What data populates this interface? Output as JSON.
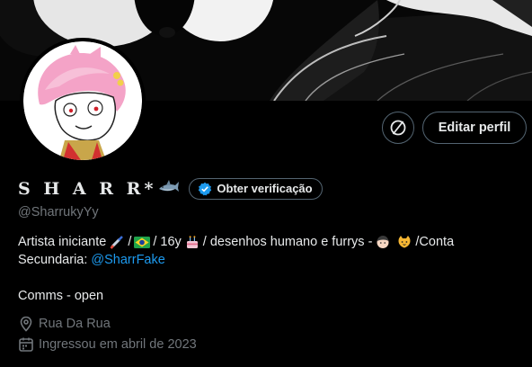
{
  "profile": {
    "display_name": "S H A R R*",
    "handle": "@SharrukyYy",
    "verify_label": "Obter verificação",
    "edit_label": "Editar perfil",
    "bio": {
      "line1_part1": "Artista iniciante",
      "line1_part2": "/",
      "line1_part3": "/ 16y",
      "line1_part4": "/ desenhos humano e furrys -",
      "line1_part5": "/Conta",
      "line2_part1": "Secundaria:",
      "line2_link": "@SharrFake",
      "comms": "Comms - open"
    },
    "location": "Rua Da Rua",
    "joined": "Ingressou em abril de 2023"
  },
  "icons": {
    "shark": "shark-emoji",
    "brush": "paintbrush-emoji",
    "flag": "brazil-flag-emoji",
    "cake": "birthday-cake-emoji",
    "person": "person-face-emoji",
    "cat": "cat-face-emoji",
    "verified": "verified-badge-icon",
    "location": "location-pin-icon",
    "calendar": "calendar-icon",
    "no-sign": "no-sign-icon"
  },
  "colors": {
    "background": "#000000",
    "text": "#e7e9ea",
    "muted": "#71767b",
    "link": "#1d9bf0",
    "border": "#536471"
  }
}
